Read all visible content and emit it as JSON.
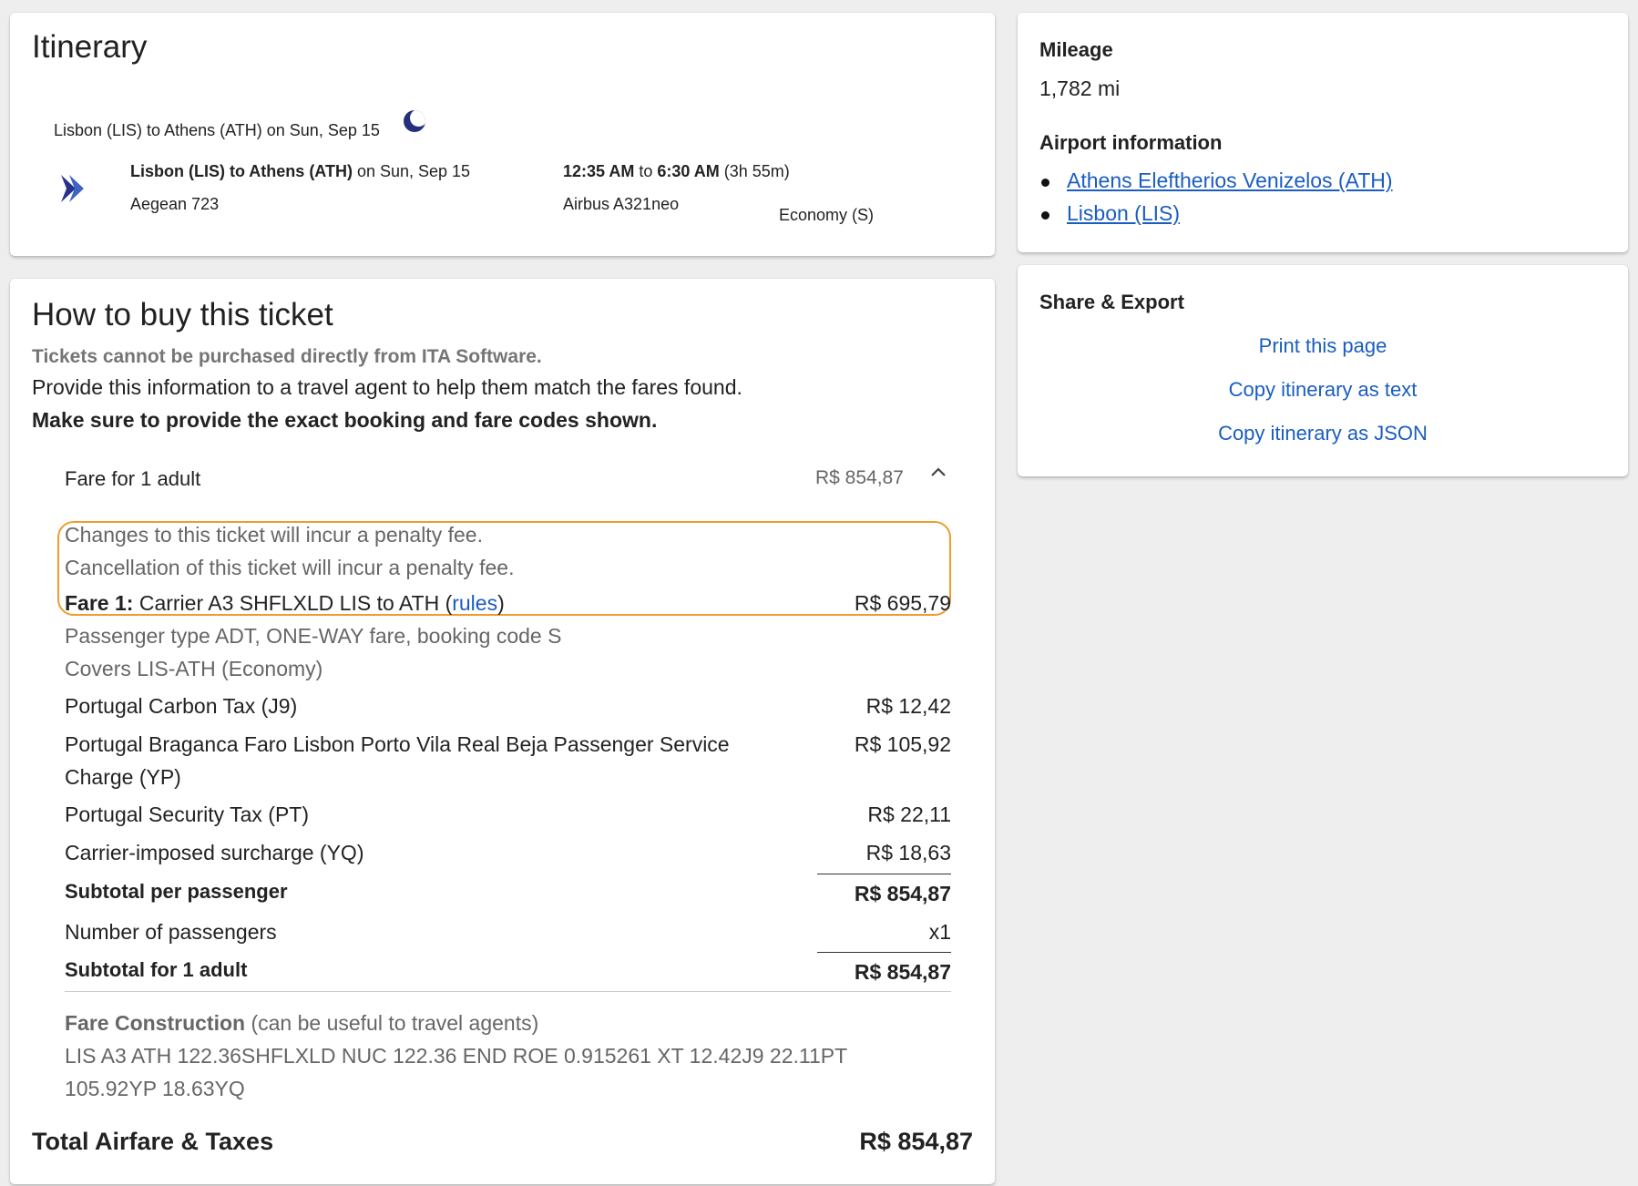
{
  "itinerary": {
    "title": "Itinerary",
    "route_header": "Lisbon (LIS) to Athens (ATH) on Sun, Sep 15",
    "route_bold": "Lisbon (LIS) to Athens (ATH)",
    "route_date": " on Sun, Sep 15",
    "flight": "Aegean 723",
    "depart_time": "12:35 AM",
    "to_word": " to ",
    "arrive_time": "6:30 AM",
    "duration": " (3h 55m)",
    "aircraft": "Airbus A321neo",
    "cabin": "Economy (S)"
  },
  "buy": {
    "title": "How to buy this ticket",
    "notice": "Tickets cannot be purchased directly from ITA Software.",
    "provide_info": "Provide this information to a travel agent to help them match the fares found.",
    "make_sure": "Make sure to provide the exact booking and fare codes shown.",
    "fare_for_label": "Fare for 1 adult",
    "fare_for_amount": "R$ 854,87",
    "change_penalty": "Changes to this ticket will incur a penalty fee.",
    "cancel_penalty": "Cancellation of this ticket will incur a penalty fee.",
    "fare1_label": "Fare 1:",
    "fare1_text": " Carrier A3 SHFLXLD LIS to ATH (",
    "fare1_rules": "rules",
    "fare1_close": ")",
    "fare1_amount": "R$ 695,79",
    "passenger_type": "Passenger type ADT, ONE-WAY fare, booking code S",
    "covers": "Covers LIS-ATH (Economy)",
    "taxes": [
      {
        "label": "Portugal Carbon Tax (J9)",
        "amount": "R$ 12,42"
      },
      {
        "label": "Portugal Braganca Faro Lisbon Porto Vila Real Beja Passenger Service",
        "label2": "Charge (YP)",
        "amount": "R$ 105,92"
      },
      {
        "label": "Portugal Security Tax (PT)",
        "amount": "R$ 22,11"
      },
      {
        "label": "Carrier-imposed surcharge (YQ)",
        "amount": "R$ 18,63"
      }
    ],
    "subtotal_pp_label": "Subtotal per passenger",
    "subtotal_pp_amount": "R$ 854,87",
    "num_passengers_label": "Number of passengers",
    "num_passengers_value": "x1",
    "subtotal_adult_label": "Subtotal for 1 adult",
    "subtotal_adult_amount": "R$ 854,87",
    "fare_construction_label": "Fare Construction",
    "fare_construction_note": " (can be useful to travel agents)",
    "fare_construction_line1": "LIS A3 ATH 122.36SHFLXLD NUC 122.36 END ROE 0.915261 XT 12.42J9 22.11PT",
    "fare_construction_line2": "105.92YP 18.63YQ",
    "total_label": "Total Airfare & Taxes",
    "total_amount": "R$ 854,87"
  },
  "info": {
    "mileage_title": "Mileage",
    "mileage_value": "1,782 mi",
    "airport_title": "Airport information",
    "airports": [
      "Athens Eleftherios Venizelos (ATH)",
      "Lisbon (LIS)"
    ]
  },
  "share": {
    "title": "Share & Export",
    "print": "Print this page",
    "copy_text": "Copy itinerary as text",
    "copy_json": "Copy itinerary as JSON"
  },
  "icons": {
    "airline_logo": "aegean-logo-icon",
    "overnight": "moon-icon",
    "collapse": "chevron-up-icon"
  },
  "colors": {
    "link": "#1a5dbf",
    "highlight_border": "#f09b2c",
    "airline_logo": "#27328c"
  }
}
